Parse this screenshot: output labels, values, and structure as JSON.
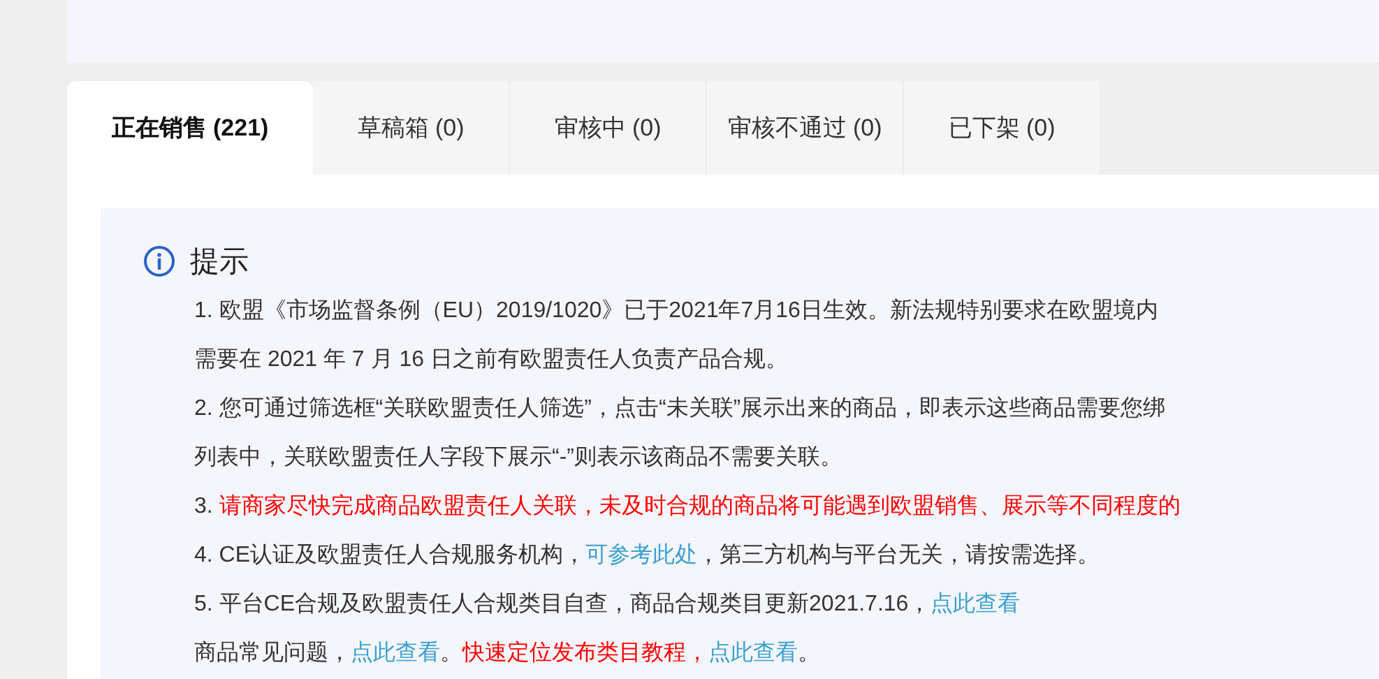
{
  "tabs": [
    {
      "label": "正在销售 (221)",
      "selected": true
    },
    {
      "label": "草稿箱 (0)",
      "selected": false
    },
    {
      "label": "审核中 (0)",
      "selected": false
    },
    {
      "label": "审核不通过 (0)",
      "selected": false
    },
    {
      "label": "已下架 (0)",
      "selected": false
    }
  ],
  "tip": {
    "title": "提示",
    "lines": [
      [
        {
          "kind": "text",
          "text": "1. 欧盟《市场监督条例（EU）2019/1020》已于2021年7月16日生效。新法规特别要求在欧盟境内"
        }
      ],
      [
        {
          "kind": "text",
          "text": "需要在 2021 年 7 月 16 日之前有欧盟责任人负责产品合规。"
        }
      ],
      [
        {
          "kind": "text",
          "text": "2. 您可通过筛选框“关联欧盟责任人筛选”，点击“未关联”展示出来的商品，即表示这些商品需要您绑"
        }
      ],
      [
        {
          "kind": "text",
          "text": "列表中，关联欧盟责任人字段下展示“-”则表示该商品不需要关联。"
        }
      ],
      [
        {
          "kind": "text",
          "text": "3. "
        },
        {
          "kind": "warning",
          "text": "请商家尽快完成商品欧盟责任人关联，未及时合规的商品将可能遇到欧盟销售、展示等不同程度的"
        }
      ],
      [
        {
          "kind": "text",
          "text": "4. CE认证及欧盟责任人合规服务机构，"
        },
        {
          "kind": "link",
          "text": "可参考此处"
        },
        {
          "kind": "text",
          "text": "，第三方机构与平台无关，请按需选择。"
        }
      ],
      [
        {
          "kind": "text",
          "text": "5. 平台CE合规及欧盟责任人合规类目自查，商品合规类目更新2021.7.16，"
        },
        {
          "kind": "link",
          "text": "点此查看"
        }
      ],
      [
        {
          "kind": "text",
          "text": "商品常见问题，"
        },
        {
          "kind": "link",
          "text": "点此查看"
        },
        {
          "kind": "text",
          "text": "。"
        },
        {
          "kind": "warning",
          "text": "快速定位发布类目教程，"
        },
        {
          "kind": "link",
          "text": "点此查看"
        },
        {
          "kind": "text",
          "text": "。"
        }
      ]
    ]
  }
}
